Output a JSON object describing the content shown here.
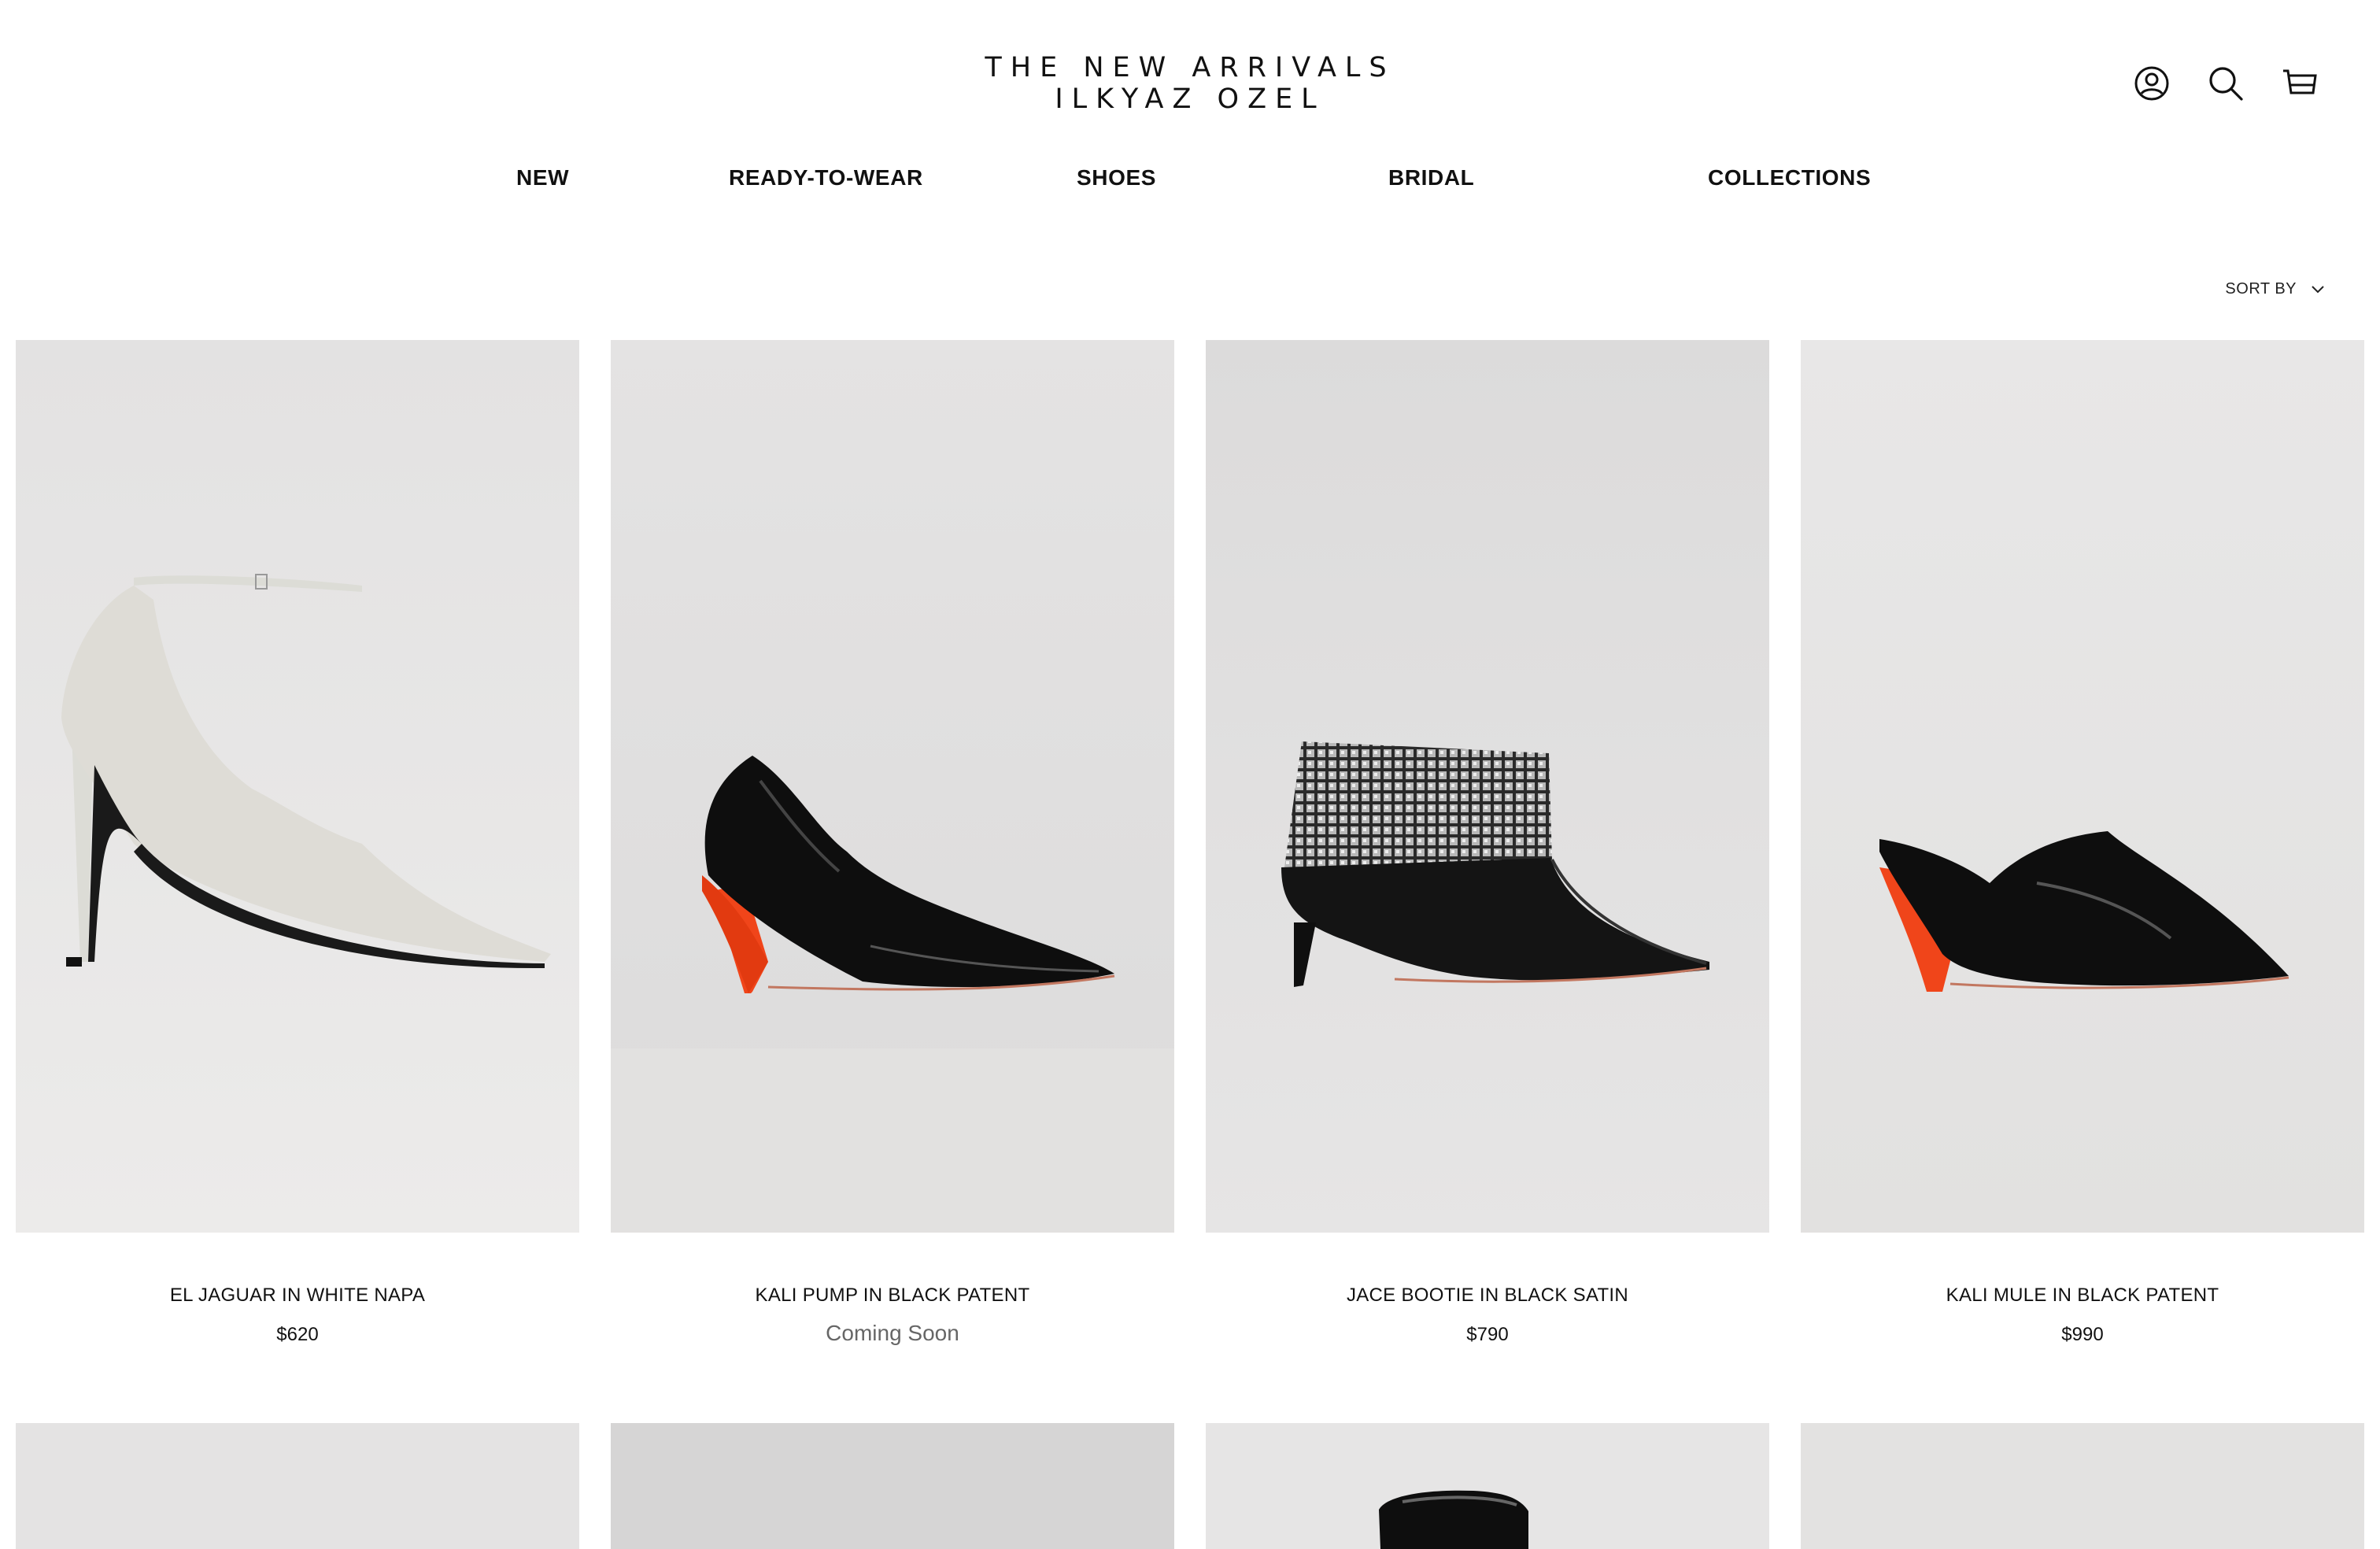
{
  "header": {
    "logo_line1": "THE NEW ARRIVALS",
    "logo_line2": "ILKYAZ OZEL",
    "icons": [
      "account-icon",
      "search-icon",
      "cart-icon"
    ]
  },
  "nav": {
    "items": [
      {
        "label": "NEW"
      },
      {
        "label": "READY-TO-WEAR"
      },
      {
        "label": "SHOES"
      },
      {
        "label": "BRIDAL"
      },
      {
        "label": "COLLECTIONS"
      }
    ]
  },
  "sort": {
    "label": "SORT BY"
  },
  "products": [
    {
      "title": "EL JAGUAR IN WHITE NAPA",
      "price": "$620",
      "color": "white"
    },
    {
      "title": "KALI PUMP IN BLACK PATENT",
      "price": "Coming Soon",
      "color": "black-orange"
    },
    {
      "title": "JACE BOOTIE IN BLACK SATIN",
      "price": "$790",
      "color": "black-crystal"
    },
    {
      "title": "KALI MULE IN BLACK PATENT",
      "price": "$990",
      "color": "black-orange"
    }
  ],
  "colors": {
    "background": "#ffffff",
    "text": "#111111",
    "muted": "#666666",
    "photo_bg": "#e6e5e5",
    "accent_heel": "#f0451a"
  }
}
